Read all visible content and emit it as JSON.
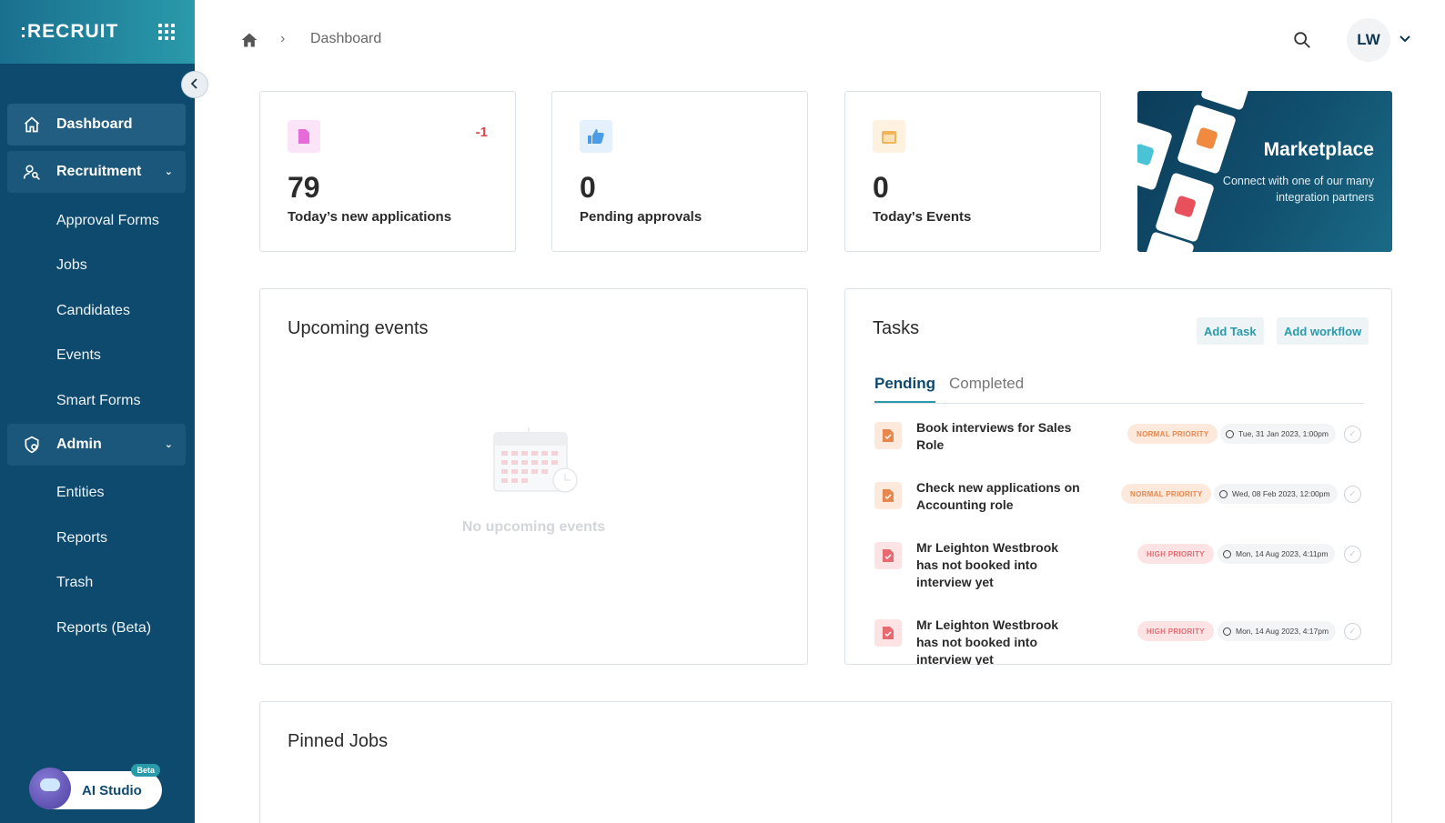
{
  "sidebar": {
    "brand": ":RECRUIT",
    "items": [
      {
        "label": "Dashboard",
        "icon": "home-icon",
        "type": "main",
        "active": true
      },
      {
        "label": "Recruitment",
        "icon": "user-search-icon",
        "type": "group"
      },
      {
        "label": "Approval Forms",
        "type": "sub"
      },
      {
        "label": "Jobs",
        "type": "sub"
      },
      {
        "label": "Candidates",
        "type": "sub"
      },
      {
        "label": "Events",
        "type": "sub"
      },
      {
        "label": "Smart Forms",
        "type": "sub"
      },
      {
        "label": "Admin",
        "icon": "admin-gear-icon",
        "type": "group"
      },
      {
        "label": "Entities",
        "type": "sub"
      },
      {
        "label": "Reports",
        "type": "sub"
      },
      {
        "label": "Trash",
        "type": "sub"
      },
      {
        "label": "Reports (Beta)",
        "type": "sub"
      }
    ],
    "ai_studio": {
      "label": "AI Studio",
      "badge": "Beta"
    }
  },
  "header": {
    "breadcrumb": "Dashboard",
    "user_initials": "LW"
  },
  "stats": [
    {
      "value": "79",
      "label": "Today’s new applications",
      "delta": "-1",
      "icon": "document-icon",
      "color": "#e66ad8",
      "bg": "#fbe4f8"
    },
    {
      "value": "0",
      "label": "Pending approvals",
      "icon": "thumbs-up-icon",
      "color": "#4a9be8",
      "bg": "#e4f0fc"
    },
    {
      "value": "0",
      "label": "Today's Events",
      "icon": "calendar-icon",
      "color": "#f2b45a",
      "bg": "#fdf1df"
    }
  ],
  "marketplace": {
    "title": "Marketplace",
    "subtitle": "Connect with one of our many integration partners"
  },
  "upcoming_events": {
    "title": "Upcoming events",
    "empty_text": "No upcoming events"
  },
  "tasks": {
    "title": "Tasks",
    "add_task": "Add Task",
    "add_workflow": "Add workflow",
    "tabs": [
      "Pending",
      "Completed"
    ],
    "items": [
      {
        "title": "Book interviews for Sales Role",
        "priority": "NORMAL PRIORITY",
        "priority_level": "normal",
        "date": "Tue, 31 Jan 2023, 1:00pm"
      },
      {
        "title": "Check new applications on Accounting role",
        "priority": "NORMAL PRIORITY",
        "priority_level": "normal",
        "date": "Wed, 08 Feb 2023, 12:00pm"
      },
      {
        "title": "Mr Leighton Westbrook has not booked into interview yet",
        "priority": "HIGH PRIORITY",
        "priority_level": "high",
        "date": "Mon, 14 Aug 2023, 4:11pm"
      },
      {
        "title": "Mr Leighton Westbrook has not booked into interview yet",
        "priority": "HIGH PRIORITY",
        "priority_level": "high",
        "date": "Mon, 14 Aug 2023, 4:17pm"
      }
    ]
  },
  "pinned_jobs": {
    "title": "Pinned Jobs"
  }
}
